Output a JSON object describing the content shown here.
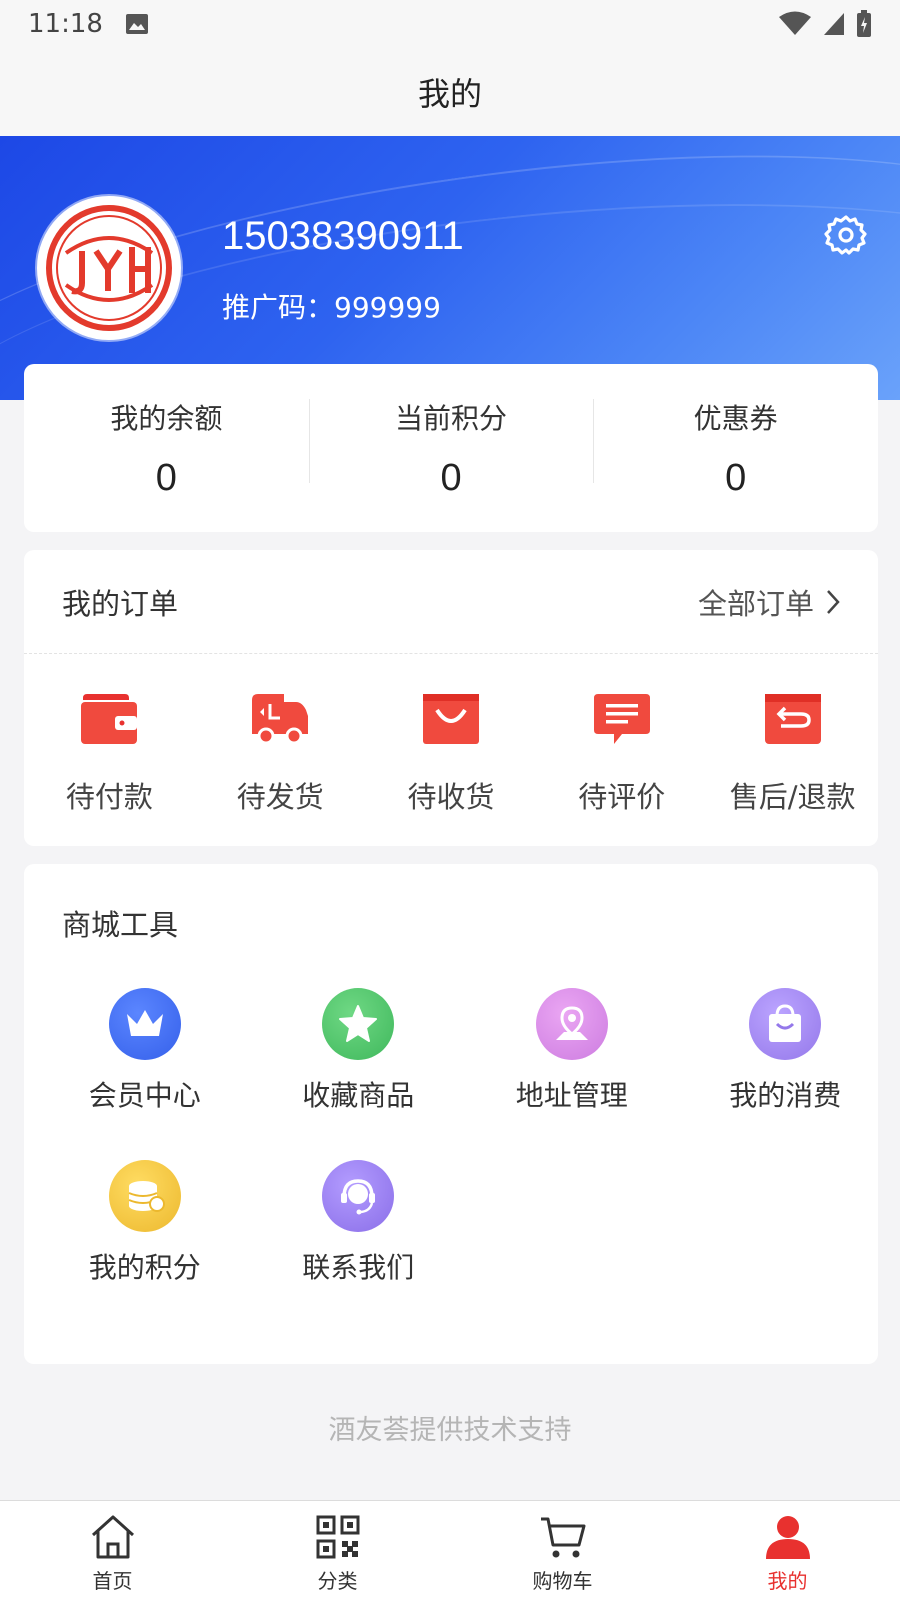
{
  "status_bar": {
    "time": "11:18"
  },
  "header": {
    "title": "我的"
  },
  "profile": {
    "logo_text": "JYH",
    "phone": "15038390911",
    "promo_label": "推广码：",
    "promo_code": "999999"
  },
  "stats": [
    {
      "label": "我的余额",
      "value": "0"
    },
    {
      "label": "当前积分",
      "value": "0"
    },
    {
      "label": "优惠券",
      "value": "0"
    }
  ],
  "orders": {
    "title": "我的订单",
    "all_label": "全部订单",
    "items": [
      {
        "label": "待付款",
        "icon": "wallet-icon"
      },
      {
        "label": "待发货",
        "icon": "truck-icon"
      },
      {
        "label": "待收货",
        "icon": "bag-icon"
      },
      {
        "label": "待评价",
        "icon": "comment-icon"
      },
      {
        "label": "售后/退款",
        "icon": "refund-icon"
      }
    ]
  },
  "tools": {
    "title": "商城工具",
    "items": [
      {
        "label": "会员中心",
        "icon": "crown-icon",
        "color": "#3f6ff0"
      },
      {
        "label": "收藏商品",
        "icon": "star-icon",
        "color": "#4bc46a"
      },
      {
        "label": "地址管理",
        "icon": "location-icon",
        "color": "#d98ce8"
      },
      {
        "label": "我的消费",
        "icon": "shopping-bag-icon",
        "color": "#a58af0"
      },
      {
        "label": "我的积分",
        "icon": "coins-icon",
        "color": "#f0c53c"
      },
      {
        "label": "联系我们",
        "icon": "headset-icon",
        "color": "#9a7ef0"
      }
    ]
  },
  "footer_note": "酒友荟提供技术支持",
  "tabbar": [
    {
      "label": "首页",
      "icon": "home-icon"
    },
    {
      "label": "分类",
      "icon": "qr-grid-icon"
    },
    {
      "label": "购物车",
      "icon": "cart-icon"
    },
    {
      "label": "我的",
      "icon": "user-icon",
      "active": true
    }
  ],
  "colors": {
    "accent": "#e8312f",
    "hero": "#2e63f0"
  }
}
